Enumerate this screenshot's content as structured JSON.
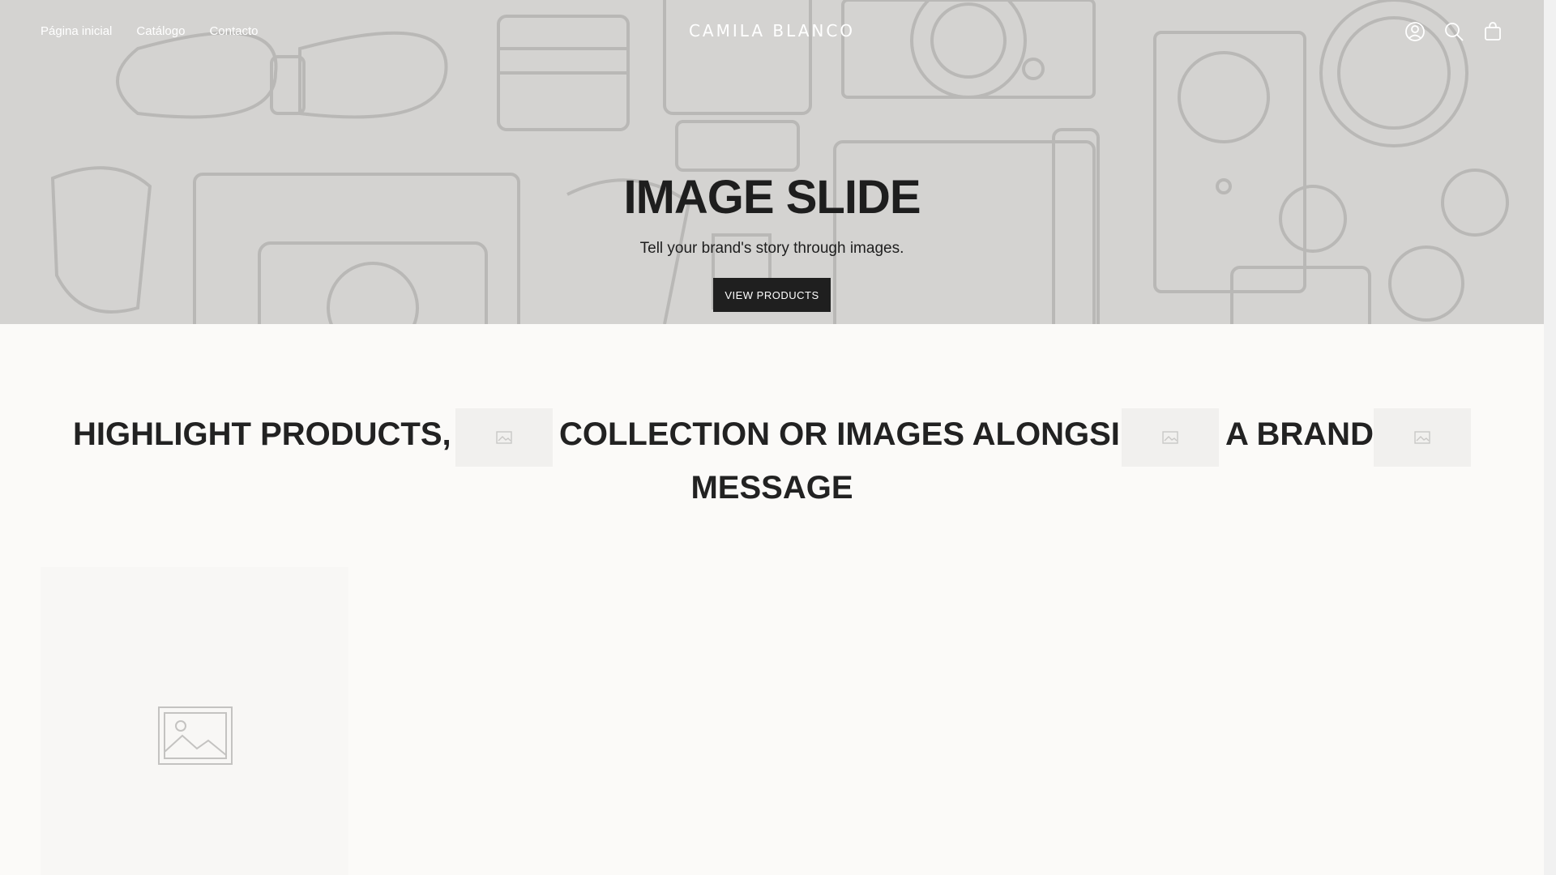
{
  "header": {
    "nav": [
      "Página inicial",
      "Catálogo",
      "Contacto"
    ],
    "logo": "CAMILA BLANCO",
    "icons": [
      "account-icon",
      "search-icon",
      "cart-icon"
    ]
  },
  "hero": {
    "title": "IMAGE SLIDE",
    "subtitle": "Tell your brand's story through images.",
    "button_label": "VIEW PRODUCTS"
  },
  "headline": {
    "words": [
      "HIGHLIGHT PRODUCTS, A",
      "COLLECTION OR IMAGES ALONGSIDE",
      "A BRAND",
      "MESSAGE"
    ]
  },
  "colors": {
    "hero_bg": "#d4d3d1",
    "page_bg": "#fbfaf8",
    "button_bg": "#1f1f1f"
  }
}
